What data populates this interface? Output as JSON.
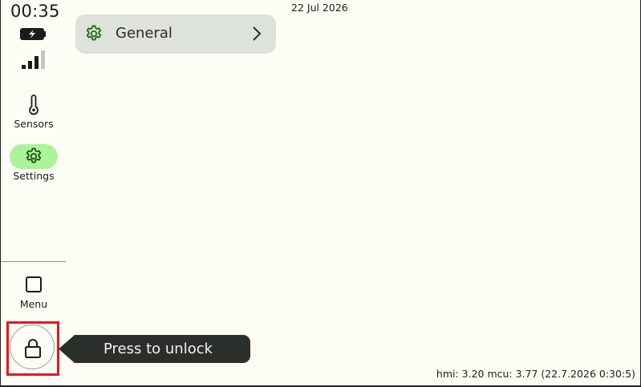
{
  "status": {
    "time": "00:35",
    "date": "22 Jul 2026",
    "battery_icon": "battery-charging-icon",
    "signal_icon": "signal-strength-icon",
    "signal_bars_filled": 3,
    "signal_bars_total": 4
  },
  "sidebar": {
    "items": [
      {
        "label": "Sensors",
        "icon": "thermometer-icon",
        "active": false
      },
      {
        "label": "Settings",
        "icon": "gear-icon",
        "active": true
      }
    ],
    "menu": {
      "label": "Menu",
      "icon": "square-icon"
    },
    "lock": {
      "icon": "lock-icon"
    }
  },
  "unlock_hint": {
    "text": "Press to unlock"
  },
  "settings_list": [
    {
      "label": "General",
      "icon": "gear-icon",
      "trailing_icon": "chevron-right-icon"
    }
  ],
  "footer": {
    "version": "hmi: 3.20 mcu: 3.77 (22.7.2026 0:30:5)"
  },
  "colors": {
    "background": "#fefdf5",
    "accent_green": "#adf39a",
    "icon_green": "#2e6b1f",
    "card": "#dde2da",
    "tooltip": "#2b2f2b",
    "highlight_red": "#e8151a"
  }
}
